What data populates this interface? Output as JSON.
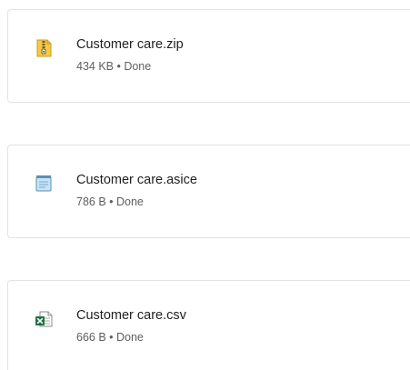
{
  "downloads": [
    {
      "icon": "zip-archive-icon",
      "filename": "Customer care.zip",
      "status": "434 KB • Done"
    },
    {
      "icon": "text-document-icon",
      "filename": "Customer care.asice",
      "status": "786 B • Done"
    },
    {
      "icon": "excel-csv-icon",
      "filename": "Customer care.csv",
      "status": "666 B • Done"
    }
  ]
}
